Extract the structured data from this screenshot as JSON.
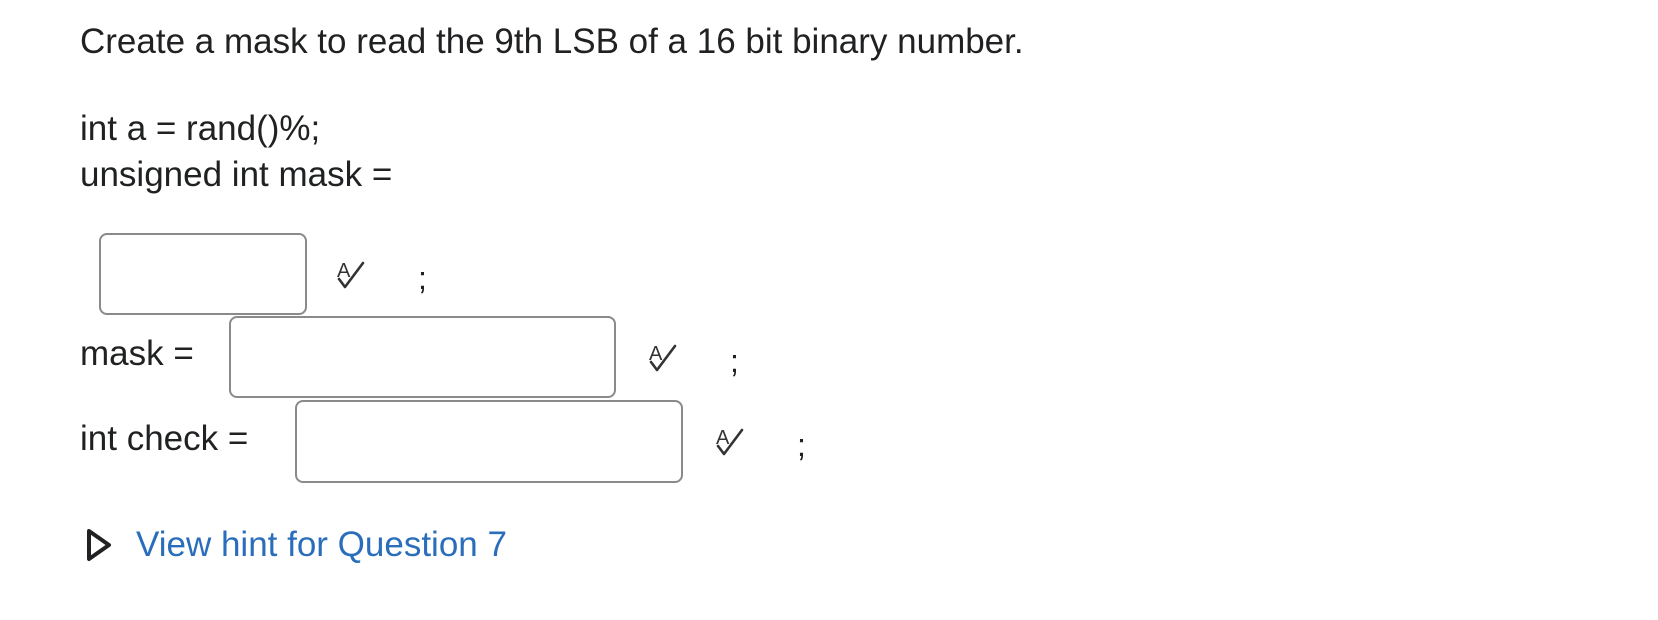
{
  "question": {
    "text": "Create a mask to read the 9th LSB of a 16 bit binary number."
  },
  "code": {
    "line1": "int a = rand()%;",
    "line2": "unsigned int mask ="
  },
  "answers": [
    {
      "label": "",
      "value": "",
      "suffix": ";"
    },
    {
      "label": "mask =",
      "value": "",
      "suffix": ";"
    },
    {
      "label": "int check =",
      "value": "",
      "suffix": ";"
    }
  ],
  "icons": {
    "spell_check": "spell-check-icon",
    "hint_caret": "caret-right-icon"
  },
  "hint": {
    "label": "View hint for Question 7"
  },
  "colors": {
    "text": "#202122",
    "link": "#2a6ebb",
    "border": "#8a8a8a"
  }
}
